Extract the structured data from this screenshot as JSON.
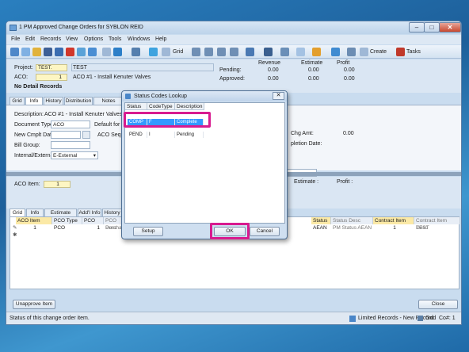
{
  "window": {
    "title": "1 PM Approved Change Orders for SYBLON REID",
    "min": "–",
    "max": "□",
    "close": "✕"
  },
  "menus": [
    "File",
    "Edit",
    "Records",
    "View",
    "Options",
    "Tools",
    "Windows",
    "Help"
  ],
  "toolbar": {
    "grid_label": "Grid",
    "create_label": "Create",
    "tasks_label": "Tasks"
  },
  "header": {
    "project_label": "Project:",
    "project_value": "TEST.",
    "project_desc": "TEST",
    "aco_label": "ACO:",
    "aco_value": "1",
    "aco_desc": "ACO #1 - Install Kenuter Valves",
    "no_detail": "No Detail Records",
    "revenue_label": "Revenue",
    "estimate_label": "Estimate",
    "profit_label": "Profit",
    "pending_label": "Pending:",
    "approved_label": "Approved:",
    "pending_revenue": "0.00",
    "pending_estimate": "0.00",
    "pending_profit": "0.00",
    "approved_revenue": "0.00",
    "approved_estimate": "0.00",
    "approved_profit": "0.00"
  },
  "top_tabs": [
    "Grid",
    "Info",
    "History",
    "Distribution",
    "Notes"
  ],
  "detail": {
    "description_label": "Description:",
    "description_value": "ACO #1 - Install Kenuter Valves",
    "doctype_label": "Document Type:",
    "doctype_value": "ACO",
    "default_for": "Default for Al",
    "cmplt_label": "New Cmplt Date:",
    "aco_seq": "ACO Sequen",
    "bill_label": "Bill Group:",
    "internal_label": "Internal/External:",
    "internal_value": "E-External",
    "chg_amt_label": "Chg Amt:",
    "chg_amt_value": "0.00",
    "completion_label": "pletion Date:"
  },
  "item_panel": {
    "aco_item_label": "ACO Item:",
    "aco_item_value": "1",
    "estimate_label": "Estimate :",
    "profit_label": "Profit :"
  },
  "bottom_tabs": [
    "Grid",
    "Info",
    "Estimate Detail",
    "Add'l Info",
    "History"
  ],
  "grid": {
    "headers": [
      "ACO Item",
      "PCO Type",
      "PCO",
      "PCO Desc",
      "Status",
      "Status Desc",
      "Contract Item",
      "Contract Item Desc"
    ],
    "row": [
      "1",
      "PCO",
      "1",
      "Purchase",
      "AEAN",
      "PM Status AEAN is",
      "1",
      "TEST"
    ]
  },
  "buttons": {
    "unapprove": "Unapprove Item",
    "close": "Close"
  },
  "statusbar": {
    "text": "Status of this change order item.",
    "limited": "Limited Records - New Record",
    "grid": "Grid",
    "co": "Co#: 1"
  },
  "dialog": {
    "title": "Status Codes Lookup",
    "close": "✕",
    "headers": [
      "Status",
      "CodeType",
      "Description"
    ],
    "rows": [
      {
        "status": "COMP",
        "codetype": "F",
        "description": "Complete"
      },
      {
        "status": "PEND",
        "codetype": "I",
        "description": "Pending"
      }
    ],
    "setup": "Setup",
    "ok": "OK",
    "cancel": "Cancel"
  },
  "colors": {
    "highlight": "#d81b8f",
    "selection": "#3399ff"
  }
}
